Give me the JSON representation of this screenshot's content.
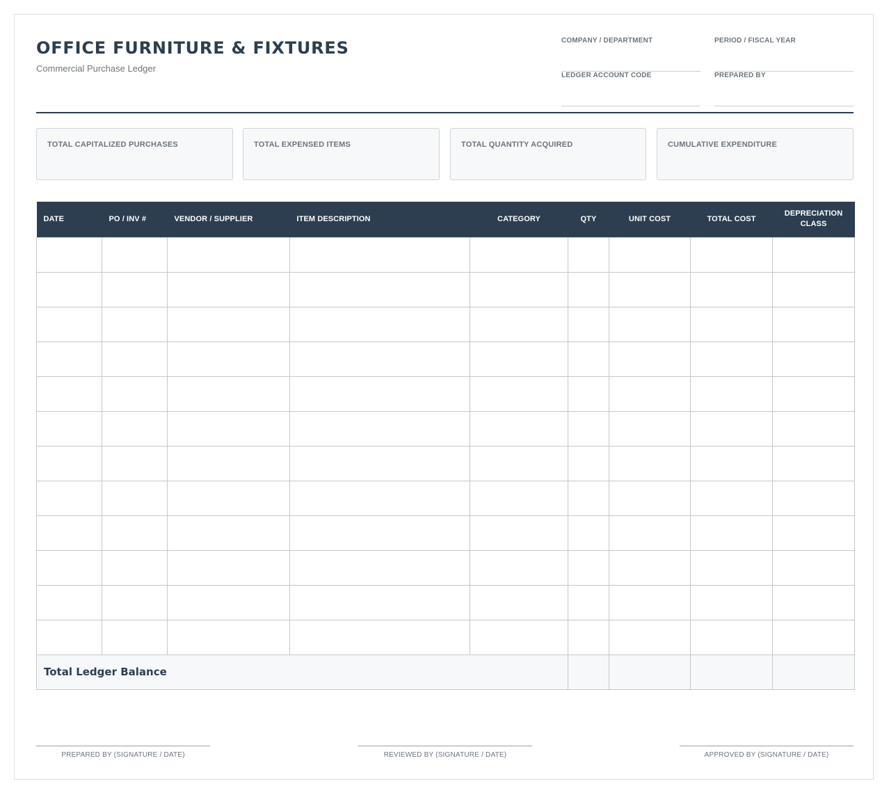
{
  "header": {
    "title": "OFFICE FURNITURE & FIXTURES",
    "subtitle": "Commercial Purchase Ledger",
    "fields": [
      {
        "label": "COMPANY / DEPARTMENT",
        "value": ""
      },
      {
        "label": "PERIOD / FISCAL YEAR",
        "value": ""
      },
      {
        "label": "LEDGER ACCOUNT CODE",
        "value": ""
      },
      {
        "label": "PREPARED BY",
        "value": ""
      }
    ]
  },
  "summary": [
    {
      "label": "TOTAL CAPITALIZED PURCHASES",
      "value": ""
    },
    {
      "label": "TOTAL EXPENSED ITEMS",
      "value": ""
    },
    {
      "label": "TOTAL QUANTITY ACQUIRED",
      "value": ""
    },
    {
      "label": "CUMULATIVE EXPENDITURE",
      "value": ""
    }
  ],
  "table": {
    "columns": [
      "DATE",
      "PO / INV #",
      "VENDOR / SUPPLIER",
      "ITEM DESCRIPTION",
      "CATEGORY",
      "QTY",
      "UNIT COST",
      "TOTAL COST",
      "DEPRECIATION CLASS"
    ],
    "row_count": 12,
    "total_label": "Total Ledger Balance"
  },
  "signatures": [
    "PREPARED BY (SIGNATURE / DATE)",
    "REVIEWED BY (SIGNATURE / DATE)",
    "APPROVED BY (SIGNATURE / DATE)"
  ]
}
